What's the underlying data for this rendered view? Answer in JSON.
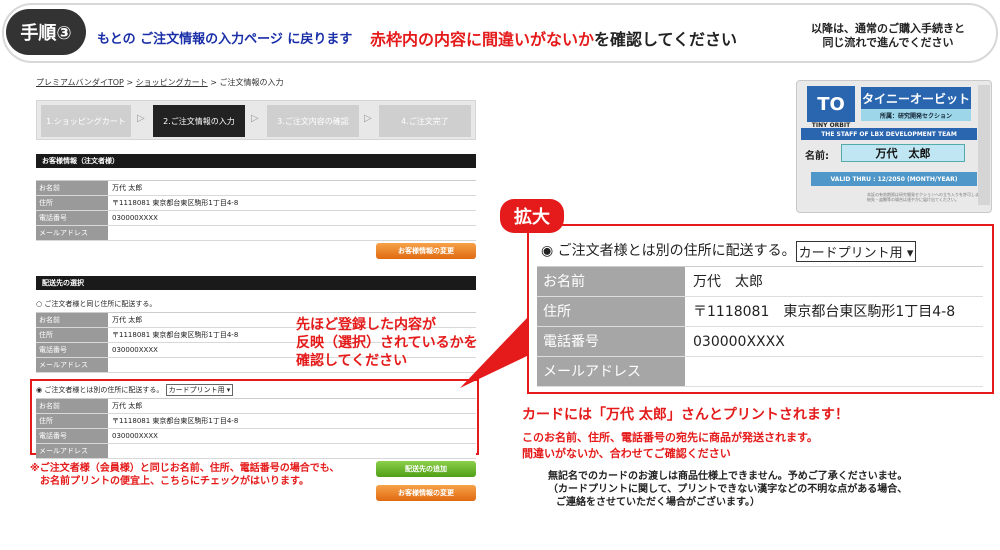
{
  "header": {
    "step": "手順③",
    "back_text": "もとの ご注文情報の入力ページ に戻ります",
    "check_red": "赤枠内の内容に間違いがないか",
    "check_rest": "を確認してください",
    "after_line1": "以降は、通常のご購入手続きと",
    "after_line2": "同じ流れで進んでください"
  },
  "breadcrumb": {
    "home": "プレミアムバンダイTOP",
    "sep": " > ",
    "cart": "ショッピングカート",
    "current": "ご注文情報の入力"
  },
  "steps": [
    "1.ショッピングカート",
    "2.ご注文情報の入力",
    "3.ご注文内容の確認",
    "4.ご注文完了"
  ],
  "customer": {
    "section_title": "お客様情報（注文者様）",
    "rows": [
      {
        "label": "お名前",
        "value": "万代 太郎"
      },
      {
        "label": "住所",
        "value": "〒1118081 東京都台東区駒形1丁目4-8"
      },
      {
        "label": "電話番号",
        "value": "030000XXXX"
      },
      {
        "label": "メールアドレス",
        "value": ""
      }
    ],
    "change_button": "お客様情報の変更"
  },
  "delivery": {
    "section_title": "配送先の選択",
    "same_option": "ご注文者様と同じ住所に配送する。",
    "rows": [
      {
        "label": "お名前",
        "value": "万代 太郎"
      },
      {
        "label": "住所",
        "value": "〒1118081 東京都台東区駒形1丁目4-8"
      },
      {
        "label": "電話番号",
        "value": "030000XXXX"
      },
      {
        "label": "メールアドレス",
        "value": ""
      }
    ],
    "other_option": "ご注文者様とは別の住所に配送する。",
    "select_value": "カードプリント用",
    "other_rows": [
      {
        "label": "お名前",
        "value": "万代 太郎"
      },
      {
        "label": "住所",
        "value": "〒1118081 東京都台東区駒形1丁目4-8"
      },
      {
        "label": "電話番号",
        "value": "030000XXXX"
      },
      {
        "label": "メールアドレス",
        "value": ""
      }
    ],
    "add_button": "配送先の追加",
    "change_button": "お客様情報の変更"
  },
  "notes": {
    "mid_line1": "先ほど登録した内容が",
    "mid_line2": "反映（選択）されているかを",
    "mid_line3": "確認してください",
    "left_line1": "※ご注文者様（会員様）と同じお名前、住所、電話番号の場合でも、",
    "left_line2": "お名前プリントの便宜上、こちらにチェックがはいります。"
  },
  "card": {
    "logo": "TO",
    "logo_sub": "TINY ORBIT",
    "title": "タイニーオービット",
    "subtitle": "所属：研究開発セクション",
    "stripe": "THE STAFF OF LBX DEVELOPMENT TEAM",
    "name_label": "名前:",
    "name": "万代　太郎",
    "valid": "VALID THRU : 12/2050 (MONTH/YEAR)",
    "small": "本証の有効期限は研究開発セクションへの立ち入りを許可します。紛失・盗難等の場合は速やかに届け出てください。"
  },
  "zoom": {
    "badge": "拡大",
    "option": "ご注文者様とは別の住所に配送する。",
    "select_value": "カードプリント用",
    "rows": [
      {
        "label": "お名前",
        "value": "万代　太郎"
      },
      {
        "label": "住所",
        "value": "〒1118081　東京都台東区駒形1丁目4-8"
      },
      {
        "label": "電話番号",
        "value": "030000XXXX"
      },
      {
        "label": "メールアドレス",
        "value": ""
      }
    ]
  },
  "right_notes": {
    "card_print": "カードには「万代 太郎」さんとプリントされます！",
    "ship_line1": "このお名前、住所、電話番号の宛先に商品が発送されます。",
    "ship_line2": "間違いがないか、合わせてご確認ください",
    "unnamed_line1": "無記名でのカードのお渡しは商品仕様上できません。予めご了承くださいませ。",
    "unnamed_line2": "（カードプリントに関して、プリントできない漢字などの不明な点がある場合、",
    "unnamed_line3": "ご連絡をさせていただく場合がございます。）"
  },
  "colors": {
    "accent_red": "#e51a1a",
    "button_orange": "#e06a10",
    "button_green": "#4f9f16",
    "link_blue": "#1a2fa8"
  }
}
